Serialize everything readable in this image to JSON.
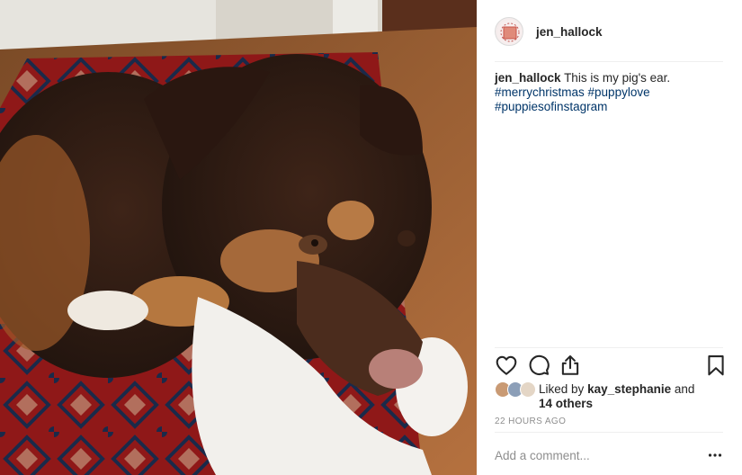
{
  "post": {
    "username": "jen_hallock",
    "caption": {
      "author": "jen_hallock",
      "text": "This is my pig's ear.",
      "hashtags": [
        "#merrychristmas",
        "#puppylove",
        "#puppiesofinstagram"
      ]
    },
    "likes": {
      "prefix": "Liked by",
      "liker": "kay_stephanie",
      "and": "and",
      "others": "14 others"
    },
    "timestamp": "22 HOURS AGO",
    "comment": {
      "placeholder": "Add a comment..."
    }
  },
  "icons": {
    "like": "heart-icon",
    "comment": "speech-bubble-icon",
    "share": "share-arrow-icon",
    "save": "bookmark-icon",
    "more": "ellipsis-icon"
  },
  "colors": {
    "text": "#262626",
    "hashtag": "#003569",
    "muted": "#8e8e8e",
    "divider": "#efefef"
  }
}
